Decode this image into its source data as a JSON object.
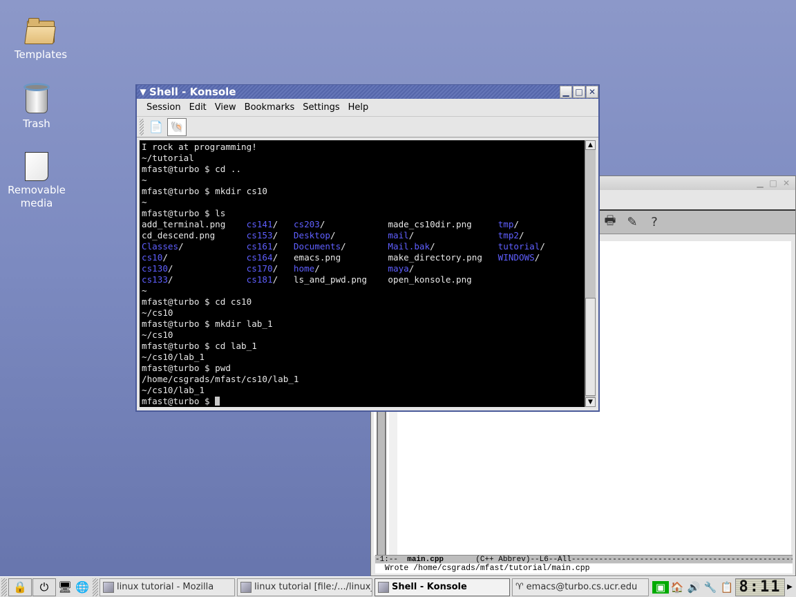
{
  "desktop": {
    "icons": [
      {
        "label": "Templates",
        "icon": "folder-icon"
      },
      {
        "label": "Trash",
        "icon": "trash-icon"
      },
      {
        "label": "Removable media",
        "icon": "removable-media-icon"
      }
    ]
  },
  "konsole": {
    "title": "Shell - Konsole",
    "menu": [
      "Session",
      "Edit",
      "View",
      "Bookmarks",
      "Settings",
      "Help"
    ],
    "toolbar": [
      {
        "name": "new-session-button",
        "icon": "new-document-icon"
      },
      {
        "name": "shell-session-button",
        "icon": "shell-icon"
      }
    ],
    "terminal_lines": [
      "I rock at programming!",
      "~/tutorial",
      "mfast@turbo $ cd ..",
      "~",
      "mfast@turbo $ mkdir cs10",
      "~",
      "mfast@turbo $ ls"
    ],
    "ls_rows": [
      [
        "add_terminal.png",
        "cs141/",
        "cs203/",
        "made_cs10dir.png",
        "tmp/"
      ],
      [
        "cd_descend.png",
        "cs153/",
        "Desktop/",
        "mail/",
        "tmp2/"
      ],
      [
        "Classes/",
        "cs161/",
        "Documents/",
        "Mail.bak/",
        "tutorial/"
      ],
      [
        "cs10/",
        "cs164/",
        "emacs.png",
        "make_directory.png",
        "WINDOWS/"
      ],
      [
        "cs130/",
        "cs170/",
        "home/",
        "maya/",
        ""
      ],
      [
        "cs133/",
        "cs181/",
        "ls_and_pwd.png",
        "open_konsole.png",
        ""
      ]
    ],
    "ls_dirs": [
      [
        false,
        true,
        true,
        false,
        true
      ],
      [
        false,
        true,
        true,
        true,
        true
      ],
      [
        true,
        true,
        true,
        true,
        true
      ],
      [
        true,
        true,
        false,
        false,
        true
      ],
      [
        true,
        true,
        true,
        true,
        false
      ],
      [
        true,
        true,
        false,
        false,
        false
      ]
    ],
    "terminal_lines_after": [
      "~",
      "mfast@turbo $ cd cs10",
      "~/cs10",
      "mfast@turbo $ mkdir lab_1",
      "~/cs10",
      "mfast@turbo $ cd lab_1",
      "~/cs10/lab_1",
      "mfast@turbo $ pwd",
      "/home/csgrads/mfast/cs10/lab_1",
      "~/cs10/lab_1"
    ],
    "prompt": "mfast@turbo $ ",
    "colors": {
      "directory": "#5f5fff",
      "text": "#e8e8e8",
      "background": "#000000"
    }
  },
  "emacs": {
    "modeline_prefix": "-1:--  ",
    "modeline_buffer": "main.cpp",
    "modeline_rest": "       (C++ Abbrev)--L6--All--------------------------------------------------------",
    "minibuffer": "Wrote /home/csgrads/mfast/tutorial/main.cpp",
    "toolbar_icons": [
      "print-icon",
      "spellcheck-icon",
      "help-icon"
    ]
  },
  "taskbar": {
    "tasks": [
      {
        "label": "linux tutorial - Mozilla",
        "active": false
      },
      {
        "label": "linux tutorial [file:/.../linux_tuto",
        "active": false
      },
      {
        "label": "Shell - Konsole",
        "active": true
      },
      {
        "label": "emacs@turbo.cs.ucr.edu",
        "active": false
      }
    ],
    "clock": "8:11"
  }
}
